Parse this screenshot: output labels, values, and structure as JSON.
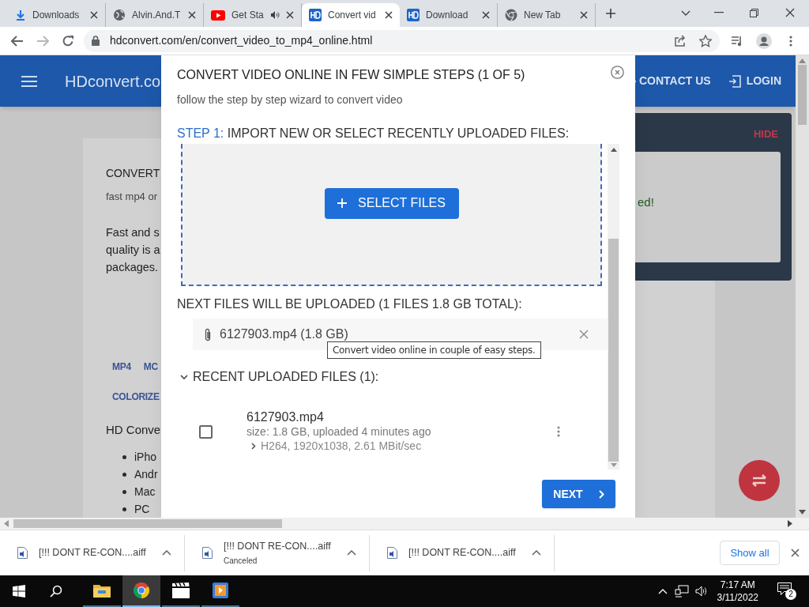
{
  "browser": {
    "tabs": [
      {
        "title": "Downloads",
        "kind": "download",
        "audio": false,
        "selected": false
      },
      {
        "title": "Alvin.And.T",
        "kind": "globe",
        "audio": false,
        "selected": false
      },
      {
        "title": "Get Sta",
        "kind": "video",
        "audio": true,
        "selected": false
      },
      {
        "title": "Convert vid",
        "kind": "site",
        "audio": false,
        "selected": true
      },
      {
        "title": "Download",
        "kind": "site",
        "audio": false,
        "selected": false
      },
      {
        "title": "New Tab",
        "kind": "browser",
        "audio": false,
        "selected": false
      }
    ],
    "address": "hdconvert.com/en/convert_video_to_mp4_online.html"
  },
  "page": {
    "logo": "HDconvert.co",
    "nav": [
      {
        "label": "CONTACT US",
        "kind": "arrow"
      },
      {
        "label": "LOGIN",
        "kind": "login"
      }
    ],
    "card": {
      "title": "CONVERT",
      "subtitle": "fast mp4 or",
      "paragraph": "Fast and s\nquality is a\npackages.",
      "links": [
        [
          "MP4",
          "MC"
        ],
        [
          "COLORIZE"
        ]
      ],
      "text": "HD Conve",
      "list": [
        "iPho",
        "Andr",
        "Mac",
        "PC"
      ]
    },
    "panel": {
      "action": "HIDE",
      "message": "ed!"
    }
  },
  "dialog": {
    "title": "CONVERT VIDEO ONLINE IN FEW SIMPLE STEPS (1 OF 5)",
    "subtitle": "follow the step by step wizard to convert video",
    "step_label": "STEP 1:",
    "step_text": "IMPORT NEW OR SELECT RECENTLY UPLOADED FILES:",
    "select_button": "SELECT FILES",
    "queue_heading": "NEXT FILES WILL BE UPLOADED (1 FILES 1.8 GB TOTAL):",
    "queue": [
      {
        "name": "6127903.mp4 (1.8 GB)"
      }
    ],
    "tooltip": "Convert video online in couple of easy steps.",
    "recent_heading": "RECENT UPLOADED FILES (1):",
    "recent_expanded": true,
    "recent": [
      {
        "name": "6127903.mp4",
        "meta": "size: 1.8 GB, uploaded 4 minutes ago",
        "details": "H264, 1920x1038, 2.61 MBit/sec",
        "expanded": false,
        "checked": false
      }
    ],
    "next_button": "NEXT"
  },
  "downloads": {
    "items": [
      {
        "name": "[!!! DONT RE-CON....aiff"
      },
      {
        "name": "[!!! DONT RE-CON....aiff",
        "status": "Canceled"
      },
      {
        "name": "[!!! DONT RE-CON....aiff"
      }
    ],
    "show_all": "Show all"
  },
  "taskbar": {
    "apps": [
      {
        "kind": "folder",
        "selected": false
      },
      {
        "kind": "browser",
        "selected": true
      },
      {
        "kind": "clapper",
        "selected": false
      },
      {
        "kind": "player",
        "selected": false
      }
    ],
    "time": "7:17 AM",
    "date": "3/11/2022",
    "notifications": "2"
  }
}
